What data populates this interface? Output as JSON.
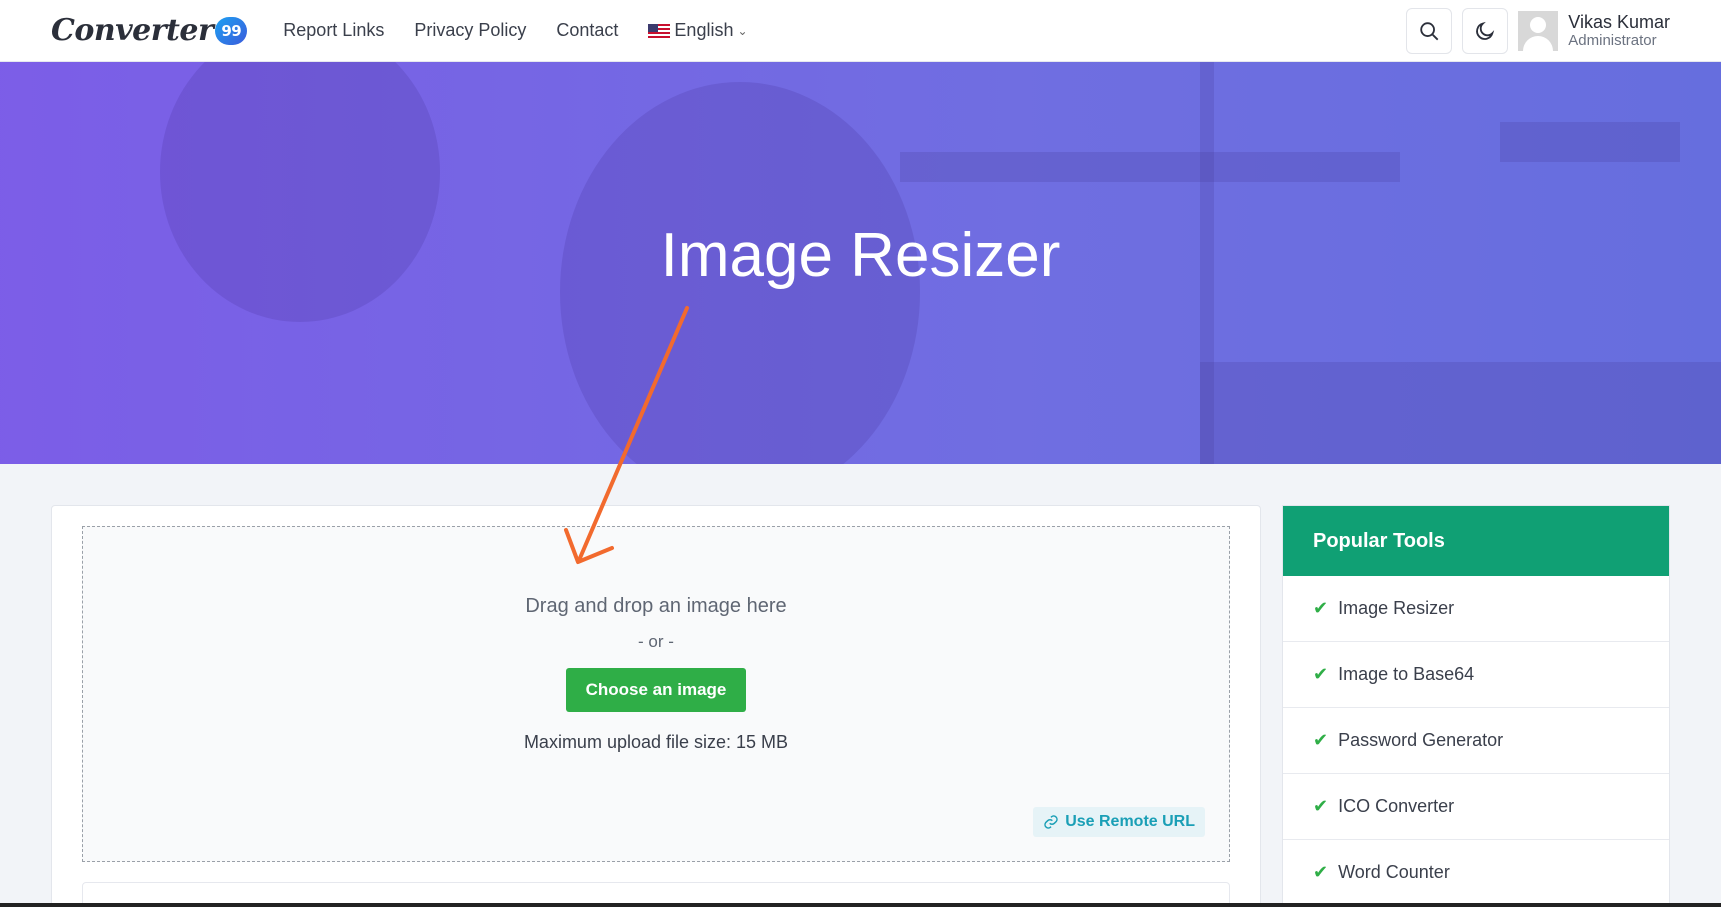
{
  "brand": {
    "name": "Converter",
    "badge": "99"
  },
  "nav": {
    "links": [
      "Report Links",
      "Privacy Policy",
      "Contact"
    ],
    "language": "English"
  },
  "icons": {
    "search": "search-icon",
    "theme": "moon-icon",
    "chevron": "chevron-down-icon",
    "check": "check-icon",
    "link": "link-icon"
  },
  "user": {
    "name": "Vikas Kumar",
    "role": "Administrator"
  },
  "hero": {
    "title": "Image Resizer"
  },
  "upload": {
    "drop_text": "Drag and drop an image here",
    "or_text": "- or -",
    "choose_label": "Choose an image",
    "max_size": "Maximum upload file size: 15 MB",
    "remote_url_label": "Use Remote URL"
  },
  "sidebar": {
    "title": "Popular Tools",
    "items": [
      "Image Resizer",
      "Image to Base64",
      "Password Generator",
      "ICO Converter",
      "Word Counter"
    ]
  },
  "colors": {
    "accent_green": "#2fae47",
    "sidebar_header": "#10a074",
    "hero": "#7a6ee0",
    "annotation_arrow": "#f26a2e",
    "remote_url": "#1a9fb6"
  }
}
